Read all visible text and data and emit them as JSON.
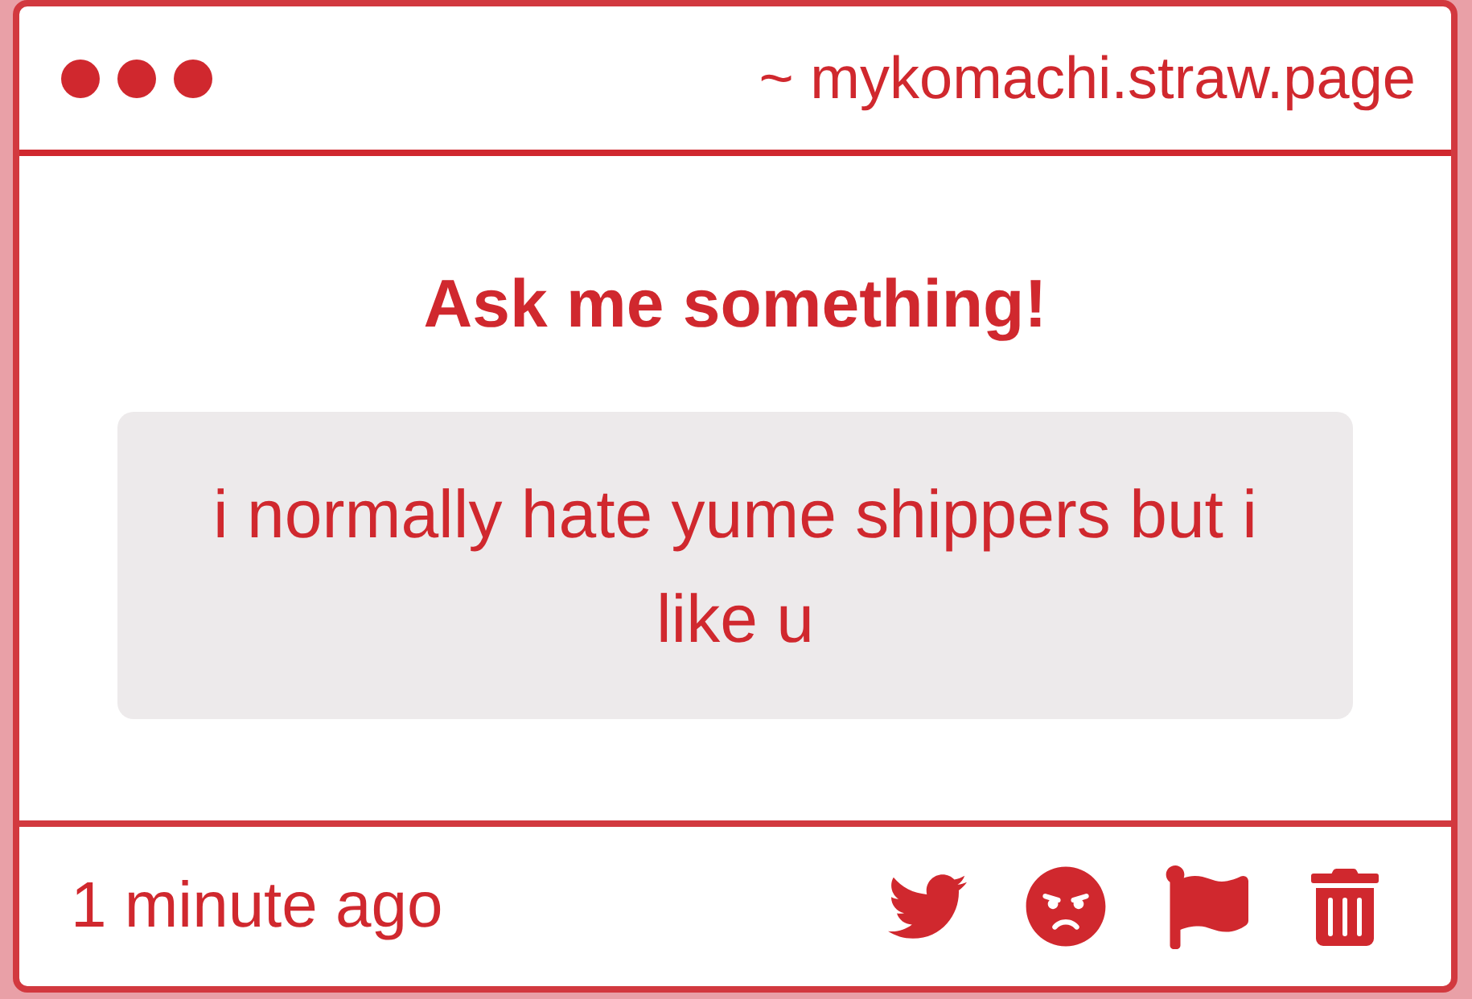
{
  "header": {
    "url": "~ mykomachi.straw.page"
  },
  "prompt": "Ask me something!",
  "question": {
    "text": "i normally hate yume shippers but i like u"
  },
  "footer": {
    "time": "1 minute ago"
  }
}
